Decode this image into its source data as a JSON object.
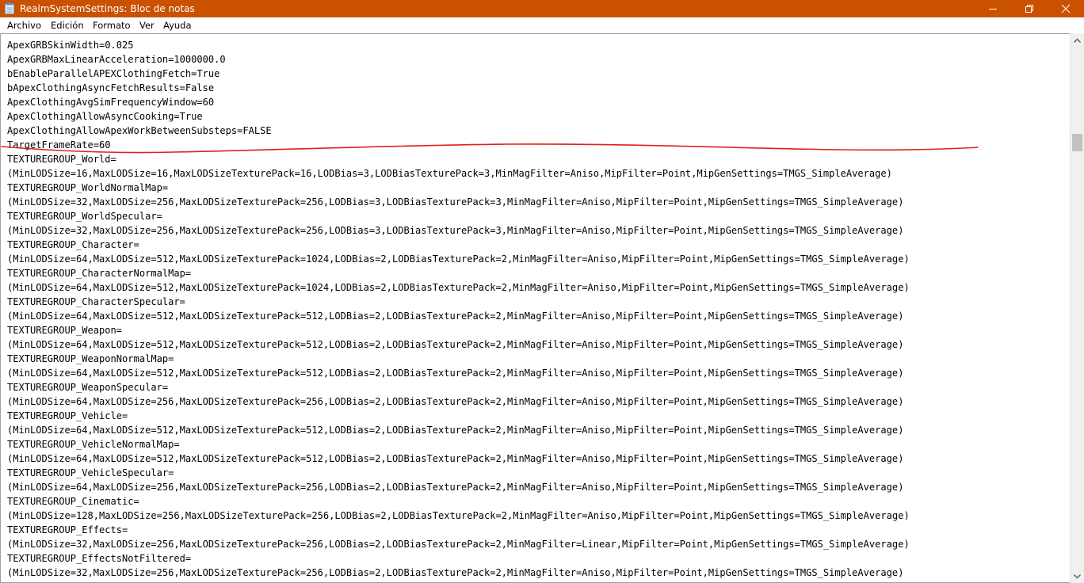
{
  "window": {
    "title": "RealmSystemSettings: Bloc de notas",
    "titlebar_color": "#ca5100",
    "controls": [
      "minimize-icon",
      "restore-icon",
      "close-icon"
    ]
  },
  "menu": {
    "file": "Archivo",
    "edit": "Edición",
    "format": "Formato",
    "view": "Ver",
    "help": "Ayuda"
  },
  "editor": {
    "content": "ApexGRBSkinWidth=0.025\nApexGRBMaxLinearAcceleration=1000000.0\nbEnableParallelAPEXClothingFetch=True\nbApexClothingAsyncFetchResults=False\nApexClothingAvgSimFrequencyWindow=60\nApexClothingAllowAsyncCooking=True\nApexClothingAllowApexWorkBetweenSubsteps=FALSE\nTargetFrameRate=60\nTEXTUREGROUP_World=\n(MinLODSize=16,MaxLODSize=16,MaxLODSizeTexturePack=16,LODBias=3,LODBiasTexturePack=3,MinMagFilter=Aniso,MipFilter=Point,MipGenSettings=TMGS_SimpleAverage)\nTEXTUREGROUP_WorldNormalMap=\n(MinLODSize=32,MaxLODSize=256,MaxLODSizeTexturePack=256,LODBias=3,LODBiasTexturePack=3,MinMagFilter=Aniso,MipFilter=Point,MipGenSettings=TMGS_SimpleAverage)\nTEXTUREGROUP_WorldSpecular=\n(MinLODSize=32,MaxLODSize=256,MaxLODSizeTexturePack=256,LODBias=3,LODBiasTexturePack=3,MinMagFilter=Aniso,MipFilter=Point,MipGenSettings=TMGS_SimpleAverage)\nTEXTUREGROUP_Character=\n(MinLODSize=64,MaxLODSize=512,MaxLODSizeTexturePack=1024,LODBias=2,LODBiasTexturePack=2,MinMagFilter=Aniso,MipFilter=Point,MipGenSettings=TMGS_SimpleAverage)\nTEXTUREGROUP_CharacterNormalMap=\n(MinLODSize=64,MaxLODSize=512,MaxLODSizeTexturePack=1024,LODBias=2,LODBiasTexturePack=2,MinMagFilter=Aniso,MipFilter=Point,MipGenSettings=TMGS_SimpleAverage)\nTEXTUREGROUP_CharacterSpecular=\n(MinLODSize=64,MaxLODSize=512,MaxLODSizeTexturePack=512,LODBias=2,LODBiasTexturePack=2,MinMagFilter=Aniso,MipFilter=Point,MipGenSettings=TMGS_SimpleAverage)\nTEXTUREGROUP_Weapon=\n(MinLODSize=64,MaxLODSize=512,MaxLODSizeTexturePack=512,LODBias=2,LODBiasTexturePack=2,MinMagFilter=Aniso,MipFilter=Point,MipGenSettings=TMGS_SimpleAverage)\nTEXTUREGROUP_WeaponNormalMap=\n(MinLODSize=64,MaxLODSize=512,MaxLODSizeTexturePack=512,LODBias=2,LODBiasTexturePack=2,MinMagFilter=Aniso,MipFilter=Point,MipGenSettings=TMGS_SimpleAverage)\nTEXTUREGROUP_WeaponSpecular=\n(MinLODSize=64,MaxLODSize=256,MaxLODSizeTexturePack=256,LODBias=2,LODBiasTexturePack=2,MinMagFilter=Aniso,MipFilter=Point,MipGenSettings=TMGS_SimpleAverage)\nTEXTUREGROUP_Vehicle=\n(MinLODSize=64,MaxLODSize=512,MaxLODSizeTexturePack=512,LODBias=2,LODBiasTexturePack=2,MinMagFilter=Aniso,MipFilter=Point,MipGenSettings=TMGS_SimpleAverage)\nTEXTUREGROUP_VehicleNormalMap=\n(MinLODSize=64,MaxLODSize=512,MaxLODSizeTexturePack=512,LODBias=2,LODBiasTexturePack=2,MinMagFilter=Aniso,MipFilter=Point,MipGenSettings=TMGS_SimpleAverage)\nTEXTUREGROUP_VehicleSpecular=\n(MinLODSize=64,MaxLODSize=256,MaxLODSizeTexturePack=256,LODBias=2,LODBiasTexturePack=2,MinMagFilter=Aniso,MipFilter=Point,MipGenSettings=TMGS_SimpleAverage)\nTEXTUREGROUP_Cinematic=\n(MinLODSize=128,MaxLODSize=256,MaxLODSizeTexturePack=256,LODBias=2,LODBiasTexturePack=2,MinMagFilter=Aniso,MipFilter=Point,MipGenSettings=TMGS_SimpleAverage)\nTEXTUREGROUP_Effects=\n(MinLODSize=32,MaxLODSize=256,MaxLODSizeTexturePack=256,LODBias=2,LODBiasTexturePack=2,MinMagFilter=Linear,MipFilter=Point,MipGenSettings=TMGS_SimpleAverage)\nTEXTUREGROUP_EffectsNotFiltered=\n(MinLODSize=32,MaxLODSize=256,MaxLODSizeTexturePack=256,LODBias=2,LODBiasTexturePack=2,MinMagFilter=Aniso,MipFilter=Point,MipGenSettings=TMGS_SimpleAverage)"
  },
  "annotation": {
    "color": "#e0201c"
  }
}
